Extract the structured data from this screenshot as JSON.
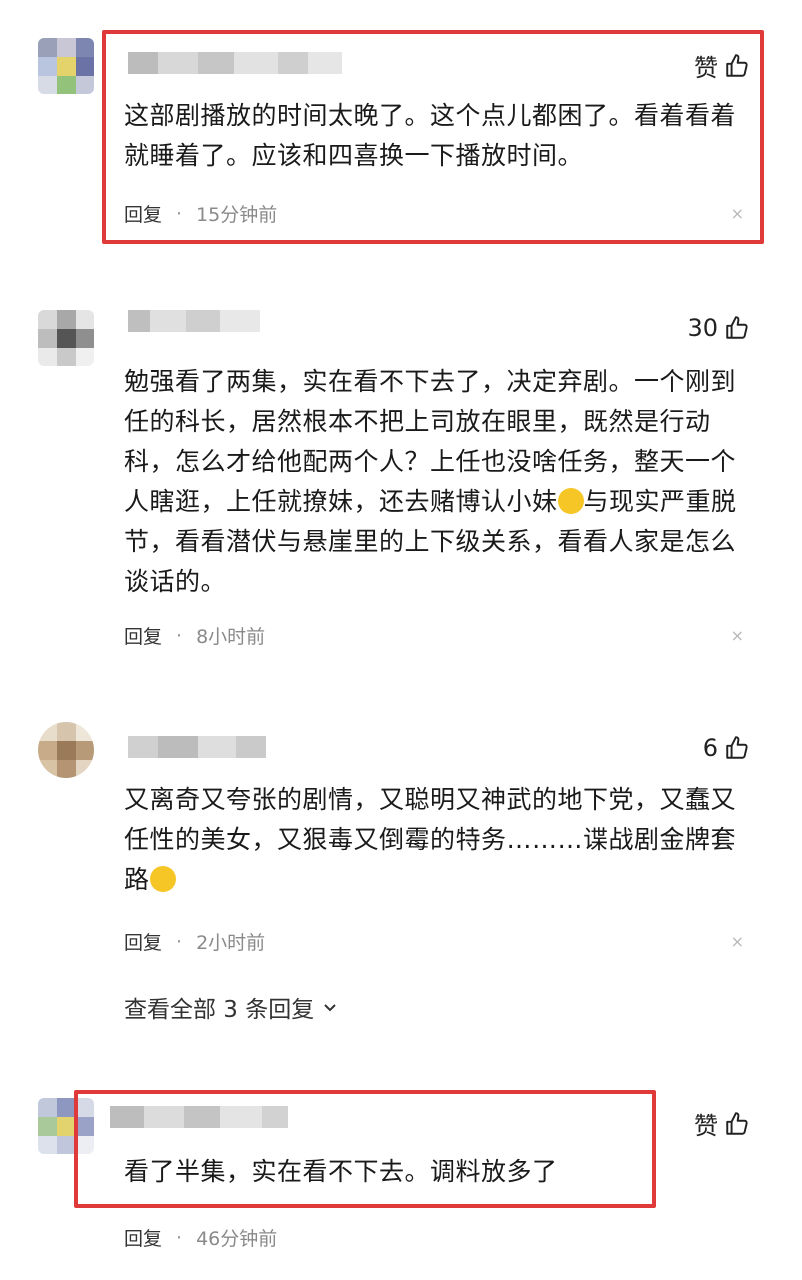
{
  "comments": [
    {
      "like_label": "赞",
      "text": "这部剧播放的时间太晚了。这个点儿都困了。看着看着就睡着了。应该和四喜换一下播放时间。",
      "reply_label": "回复",
      "separator": "·",
      "time": "15分钟前",
      "close": "×"
    },
    {
      "like_label": "30",
      "text_a": "勉强看了两集，实在看不下去了，决定弃剧。一个刚到任的科长，居然根本不把上司放在眼里，既然是行动科，怎么才给他配两个人？上任也没啥任务，整天一个人瞎逛，上任就撩妹，还去赌博认小妹",
      "text_b": "与现实严重脱节，看看潜伏与悬崖里的上下级关系，看看人家是怎么谈话的。",
      "reply_label": "回复",
      "separator": "·",
      "time": "8小时前",
      "close": "×"
    },
    {
      "like_label": "6",
      "text_a": "又离奇又夸张的剧情，又聪明又神武的地下党，又蠢又任性的美女，又狠毒又倒霉的特务………谍战剧金牌套路",
      "reply_label": "回复",
      "separator": "·",
      "time": "2小时前",
      "close": "×",
      "view_all": "查看全部 3 条回复"
    },
    {
      "like_label": "赞",
      "text": "看了半集，实在看不下去。调料放多了",
      "reply_label": "回复",
      "separator": "·",
      "time": "46分钟前"
    }
  ],
  "colors": {
    "highlight": "#e0393a",
    "muted": "#8a8a8a"
  },
  "icons": [
    "thumb-up-icon",
    "close-icon",
    "chevron-down-icon",
    "laughing-emoji-icon",
    "grinning-emoji-icon"
  ]
}
